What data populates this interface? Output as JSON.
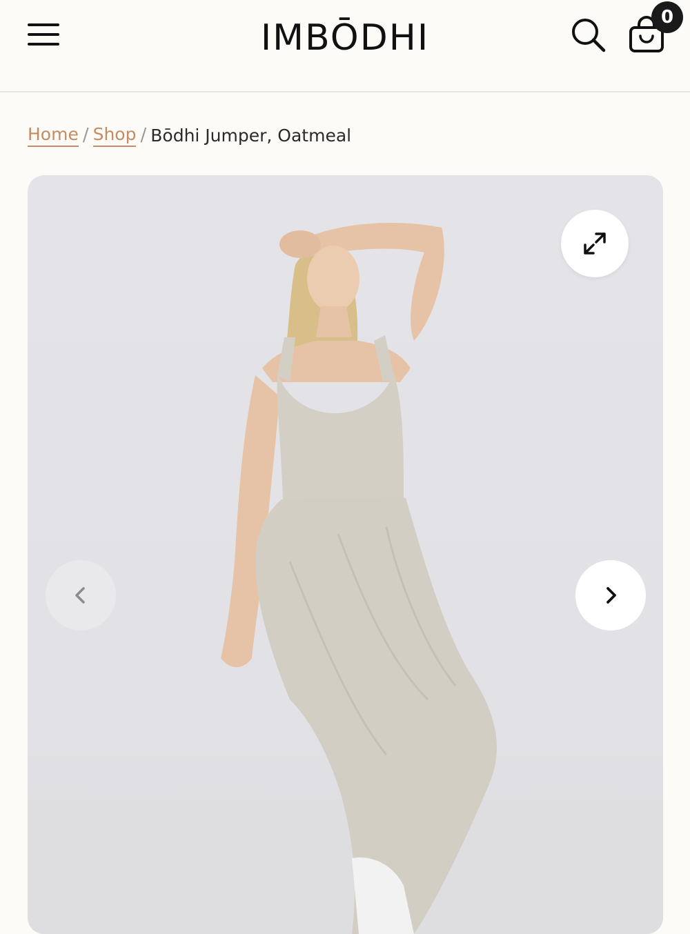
{
  "header": {
    "logo_text": "IMBŌDHI",
    "cart_count": "0",
    "icons": {
      "menu": "hamburger-menu-icon",
      "search": "search-icon",
      "cart": "shopping-bag-icon"
    }
  },
  "breadcrumb": {
    "items": [
      {
        "label": "Home"
      },
      {
        "label": "Shop"
      }
    ],
    "separator": "/",
    "current": "Bōdhi Jumper, Oatmeal"
  },
  "gallery": {
    "image_alt": "Bōdhi Jumper, Oatmeal",
    "icons": {
      "expand": "expand-arrows-icon",
      "prev": "chevron-left-icon",
      "next": "chevron-right-icon"
    }
  },
  "colors": {
    "background": "#fcfbf8",
    "accent": "#c48c62",
    "logo_accent": "#d8956a"
  }
}
